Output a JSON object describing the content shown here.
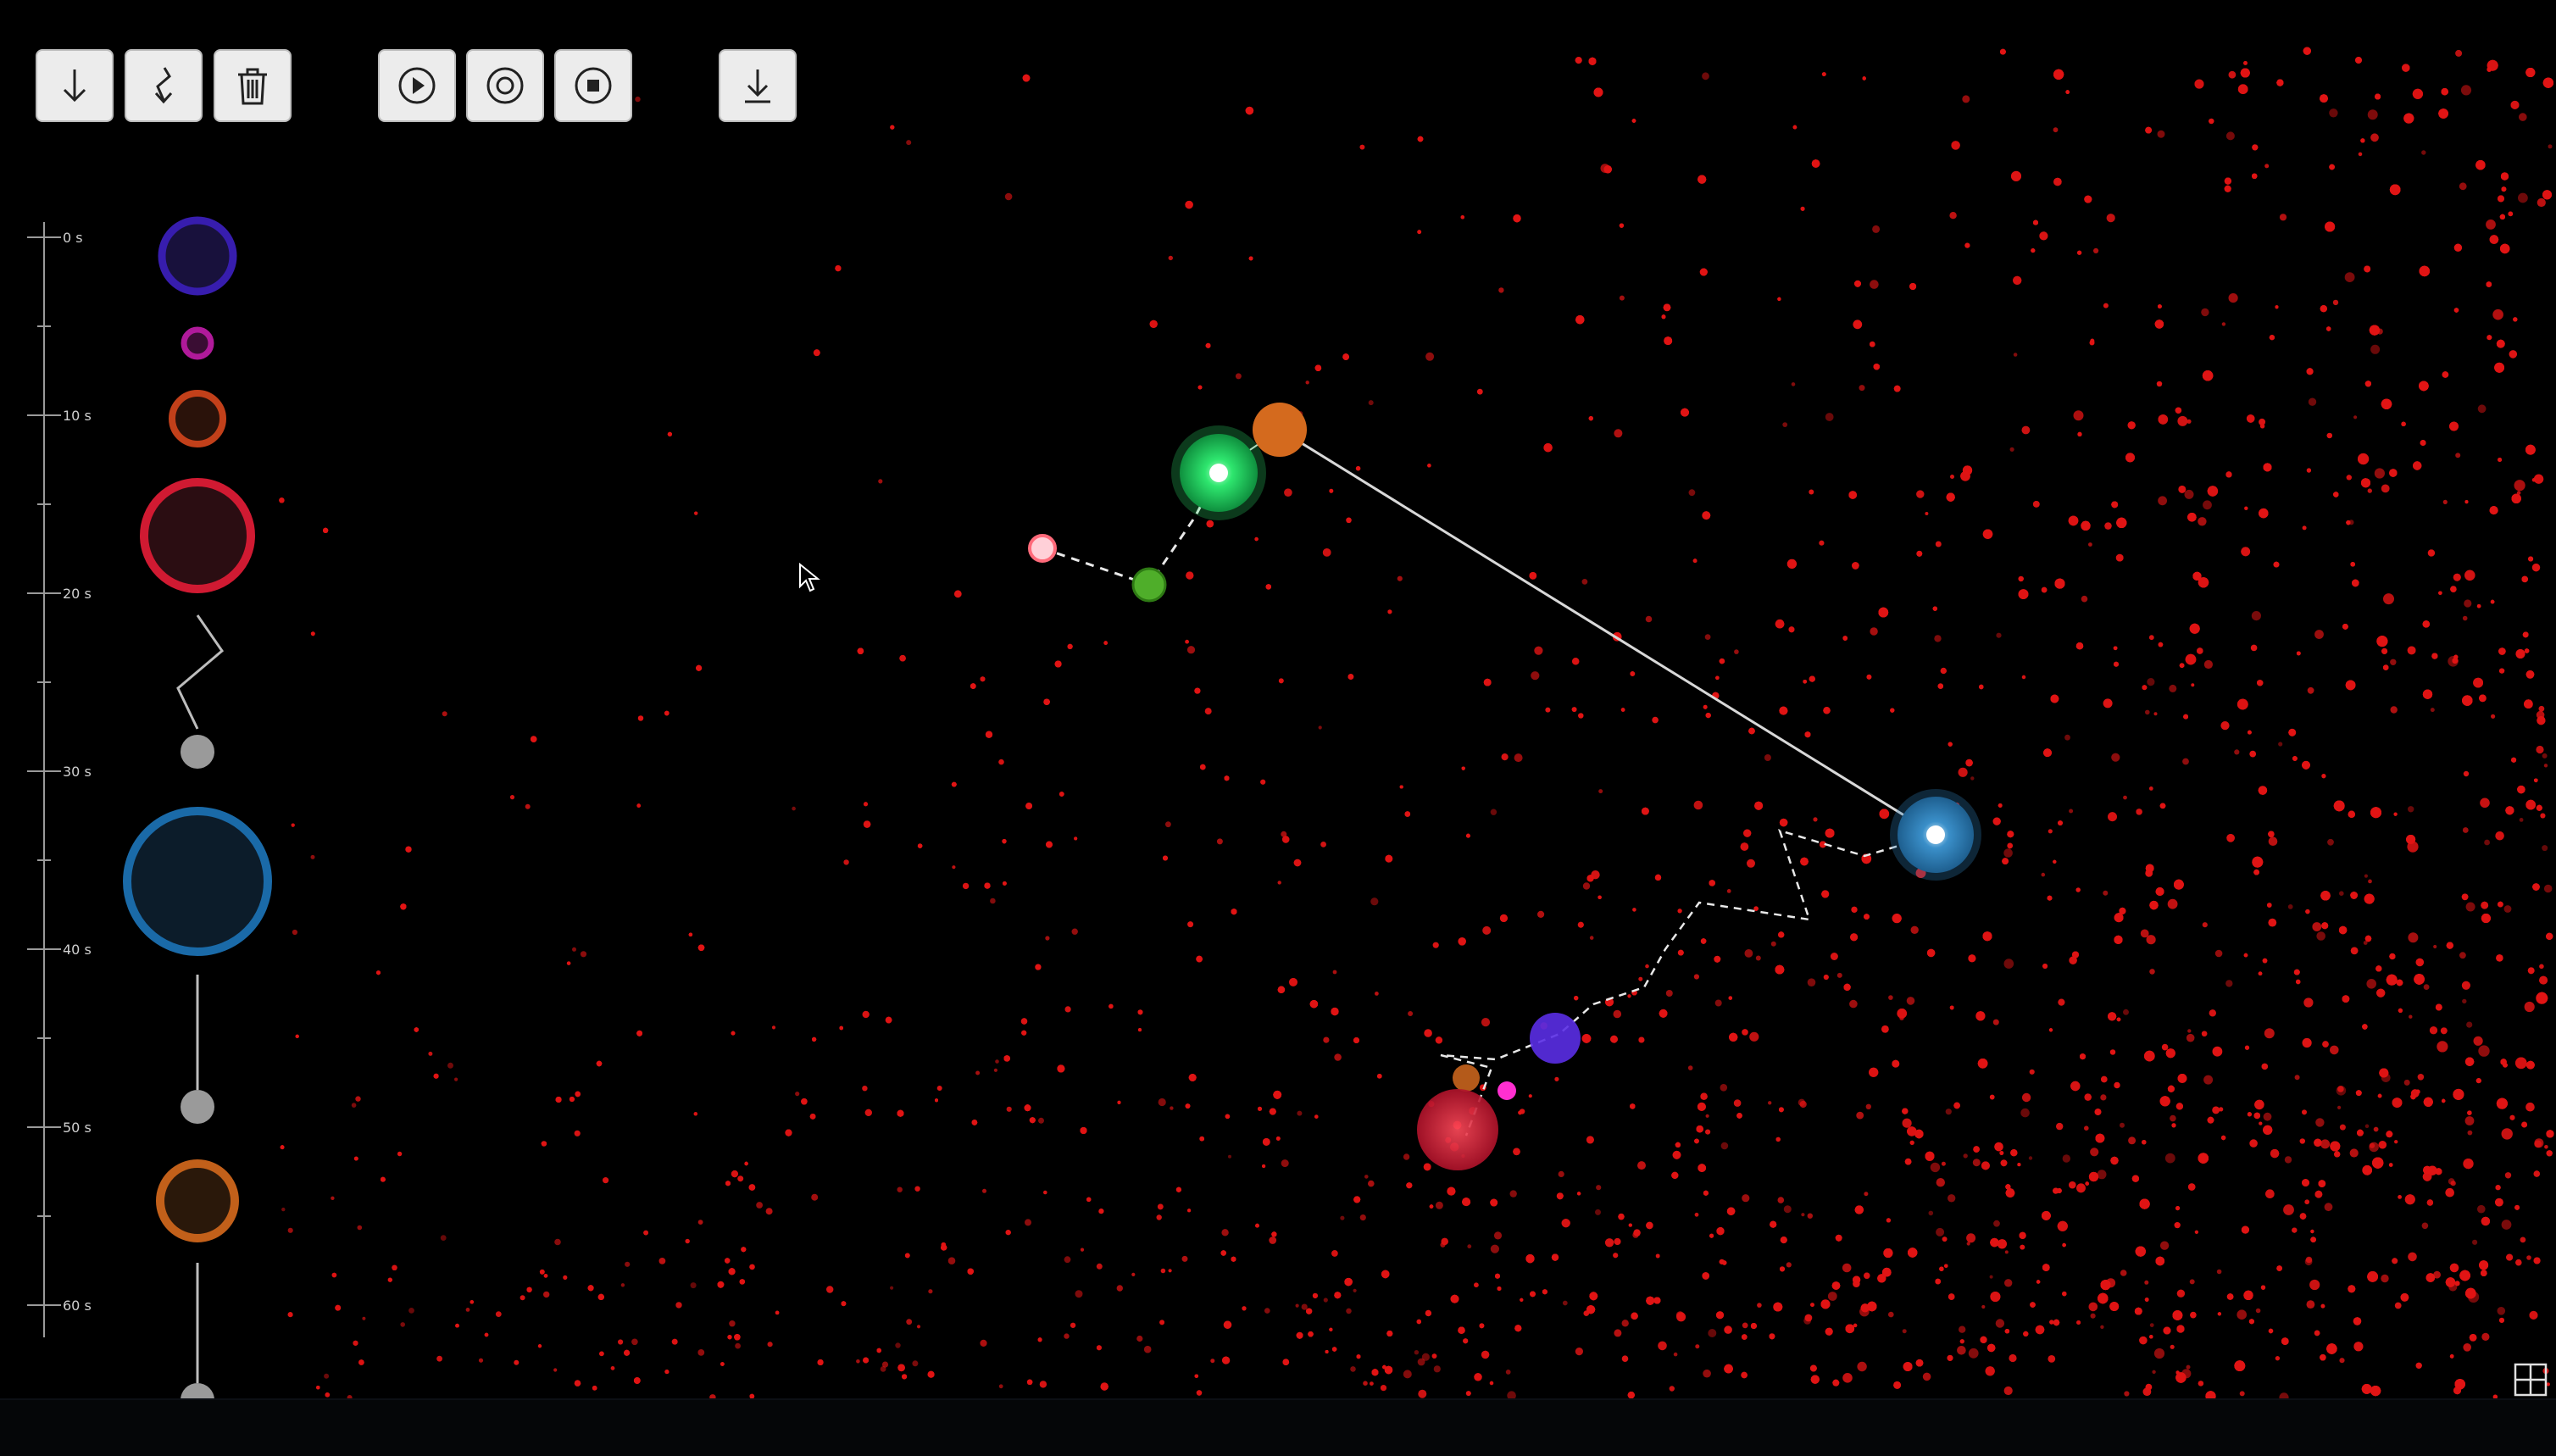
{
  "toolbar": {
    "buttons": [
      {
        "name": "drop-note-button",
        "icon": "arrow-down-icon"
      },
      {
        "name": "zigzag-drop-button",
        "icon": "zigzag-arrow-icon"
      },
      {
        "name": "delete-button",
        "icon": "trash-icon"
      },
      {
        "name": "play-button",
        "icon": "play-icon"
      },
      {
        "name": "record-button",
        "icon": "record-icon"
      },
      {
        "name": "stop-button",
        "icon": "stop-icon"
      },
      {
        "name": "download-button",
        "icon": "download-icon"
      }
    ]
  },
  "timeline": {
    "ticks": [
      "0 s",
      "10 s",
      "20 s",
      "30 s",
      "40 s",
      "50 s",
      "60 s"
    ],
    "events": [
      {
        "type": "circle",
        "color": "#3a1fb8",
        "label_at_s": 1
      },
      {
        "type": "circle",
        "color": "#b01a9a",
        "label_at_s": 5.5
      },
      {
        "type": "circle",
        "color": "#c2401a",
        "label_at_s": 10.5
      },
      {
        "type": "circle",
        "color": "#d01a32",
        "label_at_s": 16.5
      },
      {
        "type": "zigzag-drop",
        "color": "#bdbdbd",
        "label_at_s": 21
      },
      {
        "type": "circle",
        "color": "#1a6aa8",
        "label_at_s": 35
      },
      {
        "type": "straight-drop",
        "color": "#bdbdbd",
        "label_at_s": 43
      },
      {
        "type": "circle",
        "color": "#c2601a",
        "label_at_s": 52
      },
      {
        "type": "straight-drop",
        "color": "#bdbdbd",
        "label_at_s": 59
      }
    ]
  },
  "colors": {
    "background": "#000000",
    "particles": "#e01414",
    "green_node": "#2ee66e",
    "orange_node": "#d46a1e",
    "blue_node": "#2e7fb5",
    "button_bg": "#ececec"
  },
  "icons": {
    "cursor": "mouse-pointer-icon",
    "corner": "expand-grid-icon"
  }
}
